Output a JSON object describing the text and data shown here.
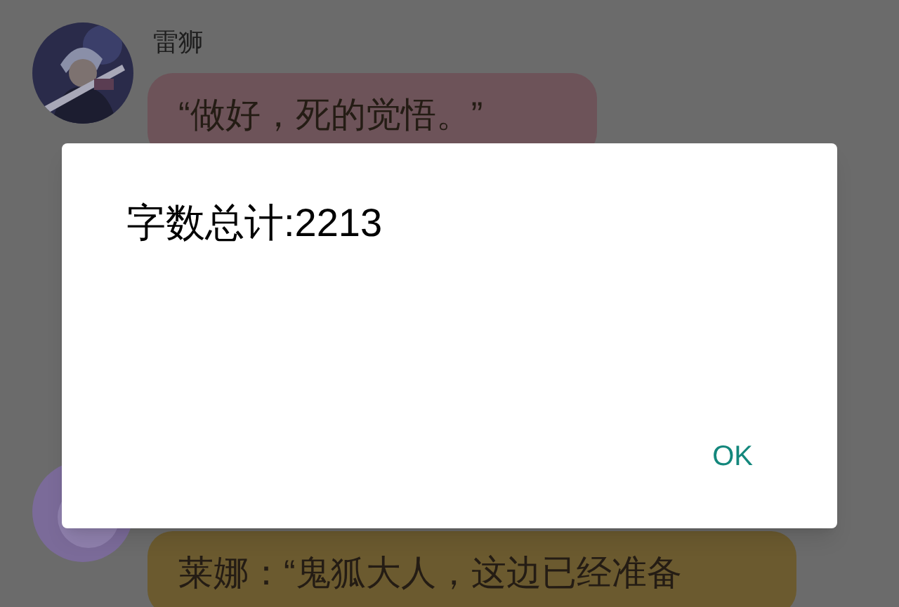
{
  "messages": [
    {
      "sender": "雷狮",
      "text": "“做好，死的觉悟。”",
      "color": "#6d5359"
    },
    {
      "avatar": {
        "kind": "icon"
      },
      "text": "莱娜：“鬼狐大人，这边已经准备",
      "color": "#6b5a2f"
    }
  ],
  "dialog": {
    "message": "字数总计:2213",
    "buttons": [
      "OK"
    ]
  }
}
